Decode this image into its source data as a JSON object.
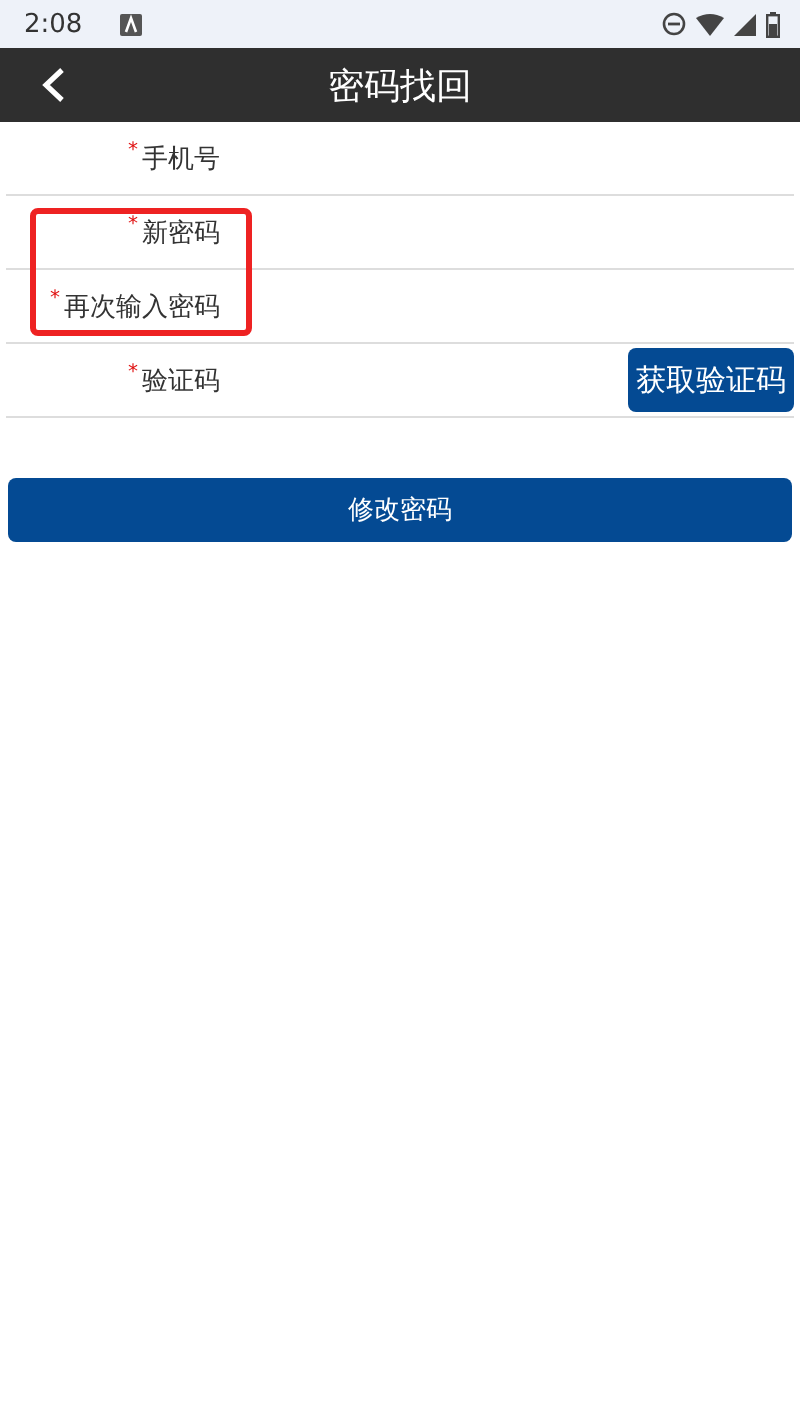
{
  "status_bar": {
    "time": "2:08"
  },
  "app_bar": {
    "title": "密码找回"
  },
  "fields": [
    {
      "kind": "text",
      "label": "手机号",
      "required_mark": "*",
      "highlighted": false
    },
    {
      "kind": "text",
      "label": "新密码",
      "required_mark": "*",
      "highlighted": true
    },
    {
      "kind": "text",
      "label": "再次输入密码",
      "required_mark": "*",
      "highlighted": true
    },
    {
      "kind": "code",
      "label": "验证码",
      "required_mark": "*",
      "highlighted": false,
      "button": "获取验证码"
    }
  ],
  "submit_button": "修改密码"
}
